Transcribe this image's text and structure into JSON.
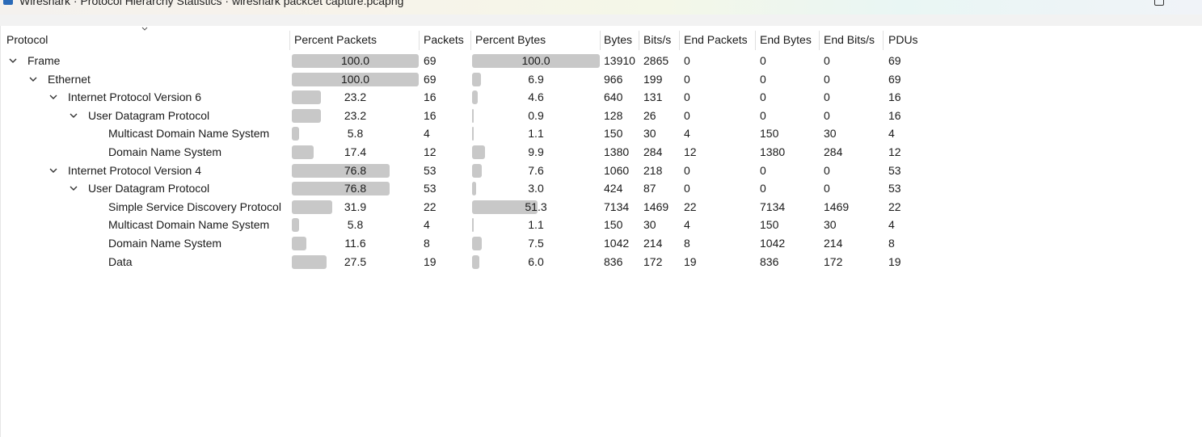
{
  "window": {
    "title": "Wireshark · Protocol Hierarchy Statistics · wireshark packcet capture.pcapng"
  },
  "columns": [
    "Protocol",
    "Percent Packets",
    "Packets",
    "Percent Bytes",
    "Bytes",
    "Bits/s",
    "End Packets",
    "End Bytes",
    "End Bits/s",
    "PDUs"
  ],
  "rows": [
    {
      "protocol": "Frame",
      "level": 0,
      "expanded": true,
      "pct_packets": "100.0",
      "packets": "69",
      "pct_bytes": "100.0",
      "bytes": "13910",
      "bits_s": "2865",
      "end_packets": "0",
      "end_bytes": "0",
      "end_bits_s": "0",
      "pdus": "69"
    },
    {
      "protocol": "Ethernet",
      "level": 1,
      "expanded": true,
      "pct_packets": "100.0",
      "packets": "69",
      "pct_bytes": "6.9",
      "bytes": "966",
      "bits_s": "199",
      "end_packets": "0",
      "end_bytes": "0",
      "end_bits_s": "0",
      "pdus": "69"
    },
    {
      "protocol": "Internet Protocol Version 6",
      "level": 2,
      "expanded": true,
      "pct_packets": "23.2",
      "packets": "16",
      "pct_bytes": "4.6",
      "bytes": "640",
      "bits_s": "131",
      "end_packets": "0",
      "end_bytes": "0",
      "end_bits_s": "0",
      "pdus": "16"
    },
    {
      "protocol": "User Datagram Protocol",
      "level": 3,
      "expanded": true,
      "pct_packets": "23.2",
      "packets": "16",
      "pct_bytes": "0.9",
      "bytes": "128",
      "bits_s": "26",
      "end_packets": "0",
      "end_bytes": "0",
      "end_bits_s": "0",
      "pdus": "16"
    },
    {
      "protocol": "Multicast Domain Name System",
      "level": 4,
      "expanded": null,
      "pct_packets": "5.8",
      "packets": "4",
      "pct_bytes": "1.1",
      "bytes": "150",
      "bits_s": "30",
      "end_packets": "4",
      "end_bytes": "150",
      "end_bits_s": "30",
      "pdus": "4"
    },
    {
      "protocol": "Domain Name System",
      "level": 4,
      "expanded": null,
      "pct_packets": "17.4",
      "packets": "12",
      "pct_bytes": "9.9",
      "bytes": "1380",
      "bits_s": "284",
      "end_packets": "12",
      "end_bytes": "1380",
      "end_bits_s": "284",
      "pdus": "12"
    },
    {
      "protocol": "Internet Protocol Version 4",
      "level": 2,
      "expanded": true,
      "pct_packets": "76.8",
      "packets": "53",
      "pct_bytes": "7.6",
      "bytes": "1060",
      "bits_s": "218",
      "end_packets": "0",
      "end_bytes": "0",
      "end_bits_s": "0",
      "pdus": "53"
    },
    {
      "protocol": "User Datagram Protocol",
      "level": 3,
      "expanded": true,
      "pct_packets": "76.8",
      "packets": "53",
      "pct_bytes": "3.0",
      "bytes": "424",
      "bits_s": "87",
      "end_packets": "0",
      "end_bytes": "0",
      "end_bits_s": "0",
      "pdus": "53"
    },
    {
      "protocol": "Simple Service Discovery Protocol",
      "level": 4,
      "expanded": null,
      "pct_packets": "31.9",
      "packets": "22",
      "pct_bytes": "51.3",
      "bytes": "7134",
      "bits_s": "1469",
      "end_packets": "22",
      "end_bytes": "7134",
      "end_bits_s": "1469",
      "pdus": "22"
    },
    {
      "protocol": "Multicast Domain Name System",
      "level": 4,
      "expanded": null,
      "pct_packets": "5.8",
      "packets": "4",
      "pct_bytes": "1.1",
      "bytes": "150",
      "bits_s": "30",
      "end_packets": "4",
      "end_bytes": "150",
      "end_bits_s": "30",
      "pdus": "4"
    },
    {
      "protocol": "Domain Name System",
      "level": 4,
      "expanded": null,
      "pct_packets": "11.6",
      "packets": "8",
      "pct_bytes": "7.5",
      "bytes": "1042",
      "bits_s": "214",
      "end_packets": "8",
      "end_bytes": "1042",
      "end_bits_s": "214",
      "pdus": "8"
    },
    {
      "protocol": "Data",
      "level": 4,
      "expanded": null,
      "pct_packets": "27.5",
      "packets": "19",
      "pct_bytes": "6.0",
      "bytes": "836",
      "bits_s": "172",
      "end_packets": "19",
      "end_bytes": "836",
      "end_bits_s": "172",
      "pdus": "19"
    }
  ],
  "icons": {
    "expand": "chevron-down-icon",
    "sort": "sort-chevron-icon",
    "window": "wireshark-app-icon",
    "maximize": "maximize-icon"
  },
  "colors": {
    "bar": "#c8c8c8",
    "header_background": "#f2f2f2"
  }
}
